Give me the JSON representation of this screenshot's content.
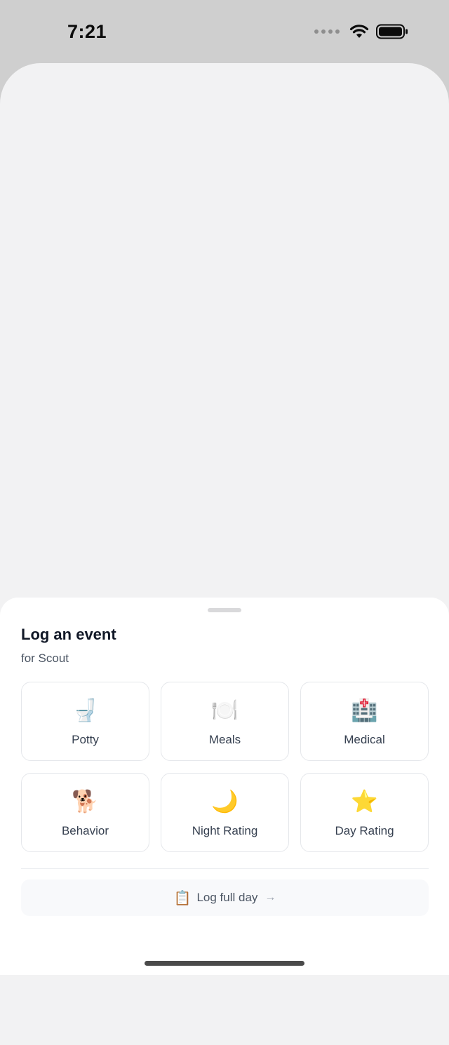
{
  "status_bar": {
    "time": "7:21",
    "icons": [
      "signal-dots-icon",
      "wifi-icon",
      "battery-icon"
    ]
  },
  "sheet": {
    "title": "Log an event",
    "subtitle": "for Scout",
    "tiles": [
      {
        "icon": "🚽",
        "label": "Potty",
        "icon_name": "toilet-icon"
      },
      {
        "icon": "🍽️",
        "label": "Meals",
        "icon_name": "plate-icon"
      },
      {
        "icon": "🏥",
        "label": "Medical",
        "icon_name": "hospital-icon"
      },
      {
        "icon": "🐕",
        "label": "Behavior",
        "icon_name": "dog-icon"
      },
      {
        "icon": "🌙",
        "label": "Night Rating",
        "icon_name": "moon-icon"
      },
      {
        "icon": "⭐",
        "label": "Day Rating",
        "icon_name": "star-icon"
      }
    ],
    "full_day": {
      "icon": "📋",
      "label": "Log full day",
      "arrow": "→"
    }
  },
  "colors": {
    "background_dim": "#cfcfcf",
    "card": "#f2f2f3",
    "sheet": "#ffffff",
    "tile_border": "#e5e7eb"
  }
}
